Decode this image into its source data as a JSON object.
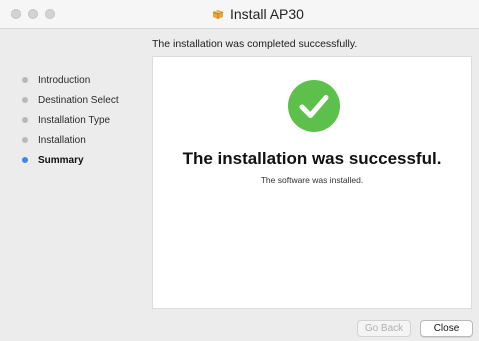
{
  "window": {
    "title": "Install AP30",
    "accent_color": "#3f88e6",
    "success_color": "#5cc04a"
  },
  "header": {
    "message": "The installation was completed successfully."
  },
  "sidebar": {
    "steps": [
      {
        "label": "Introduction",
        "active": false
      },
      {
        "label": "Destination Select",
        "active": false
      },
      {
        "label": "Installation Type",
        "active": false
      },
      {
        "label": "Installation",
        "active": false
      },
      {
        "label": "Summary",
        "active": true
      }
    ]
  },
  "content": {
    "icon": "checkmark-circle-icon",
    "title": "The installation was successful.",
    "subtitle": "The software was installed."
  },
  "footer": {
    "back_label": "Go Back",
    "close_label": "Close"
  }
}
